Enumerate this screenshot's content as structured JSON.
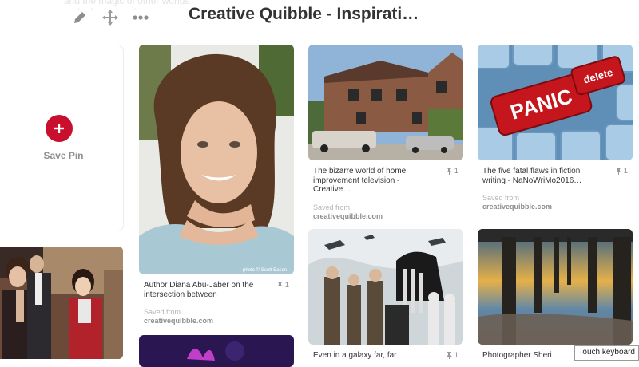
{
  "board": {
    "title": "Creative Quibble - Inspirati…",
    "faded_text": "and the magic of other worlds and other countries"
  },
  "toolbar": {
    "edit_icon": "pencil-icon",
    "move_icon": "move-arrows-icon",
    "more_icon": "ellipsis-icon"
  },
  "save_pin": {
    "label": "Save Pin",
    "icon": "plus-icon"
  },
  "pins": [
    {
      "description": "Author Diana Abu-Jaber on the intersection between",
      "repins": "1",
      "saved_from_label": "Saved from",
      "domain": "creativequibble.com",
      "image_caption": "photo © Scott Eason"
    },
    {
      "description": "The bizarre world of home improvement television - Creative…",
      "repins": "1",
      "saved_from_label": "Saved from",
      "domain": "creativequibble.com"
    },
    {
      "description": "The five fatal flaws in fiction writing - NaNoWriMo2016…",
      "repins": "1",
      "saved_from_label": "Saved from",
      "domain": "creativequibble.com",
      "key_text_panic": "PANIC",
      "key_text_delete": "delete"
    },
    {
      "description": "Even in a galaxy far, far",
      "repins": "1"
    },
    {
      "description": "Photographer Sheri"
    }
  ],
  "system": {
    "touch_keyboard": "Touch keyboard"
  },
  "colors": {
    "brand_red": "#c8102e",
    "text": "#333333",
    "muted": "#8e8e8e"
  }
}
